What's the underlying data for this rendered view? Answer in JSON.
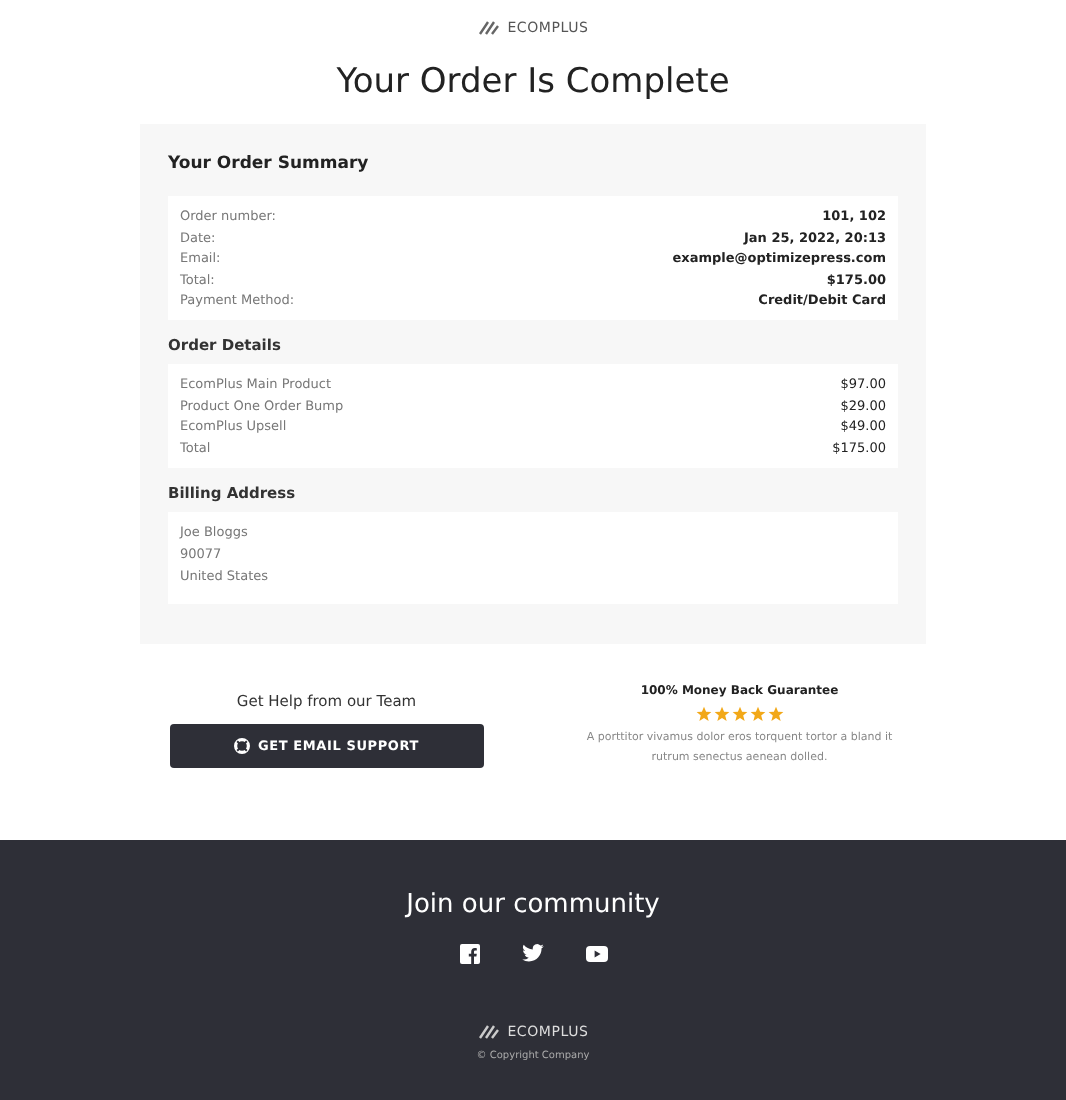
{
  "brand": {
    "name": "ECOMPLUS"
  },
  "title": "Your Order Is Complete",
  "summary": {
    "heading": "Your Order Summary",
    "rows": [
      {
        "label": "Order number:",
        "value": "101, 102"
      },
      {
        "label": "Date:",
        "value": "Jan 25, 2022, 20:13"
      },
      {
        "label": "Email:",
        "value": "example@optimizepress.com"
      },
      {
        "label": "Total:",
        "value": "$175.00"
      },
      {
        "label": "Payment Method:",
        "value": "Credit/Debit Card"
      }
    ]
  },
  "details": {
    "heading": "Order Details",
    "rows": [
      {
        "label": "EcomPlus Main Product",
        "value": "$97.00"
      },
      {
        "label": "Product One Order Bump",
        "value": "$29.00"
      },
      {
        "label": "EcomPlus Upsell",
        "value": "$49.00"
      },
      {
        "label": "Total",
        "value": "$175.00"
      }
    ]
  },
  "billing": {
    "heading": "Billing Address",
    "lines": [
      "Joe Bloggs",
      "90077",
      "United States"
    ]
  },
  "help": {
    "heading": "Get Help from our Team",
    "button": "GET EMAIL SUPPORT"
  },
  "guarantee": {
    "heading": "100% Money Back Guarantee",
    "stars": 5,
    "text": "A porttitor vivamus dolor eros torquent tortor a bland it rutrum senectus aenean dolled."
  },
  "footer": {
    "heading": "Join our community",
    "socials": [
      {
        "kind": "facebook"
      },
      {
        "kind": "twitter"
      },
      {
        "kind": "youtube"
      }
    ],
    "brand": "ECOMPLUS",
    "copyright": "© Copyright Company"
  }
}
